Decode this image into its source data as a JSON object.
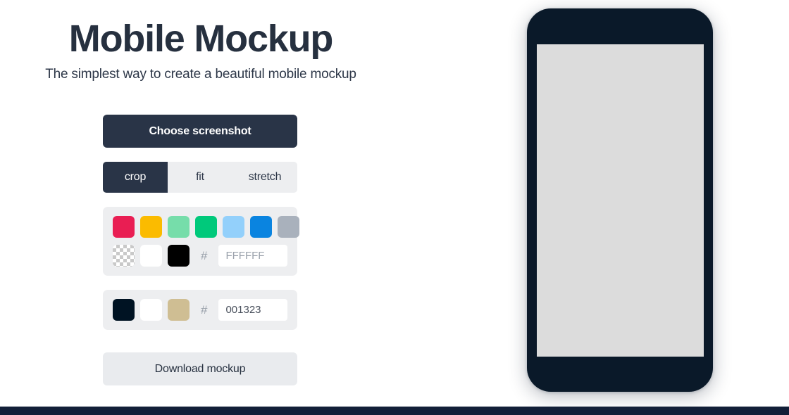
{
  "header": {
    "title": "Mobile Mockup",
    "subtitle": "The simplest way to create a beautiful mobile mockup"
  },
  "controls": {
    "choose_label": "Choose screenshot",
    "download_label": "Download mockup",
    "fit_modes": [
      {
        "label": "crop",
        "active": true
      },
      {
        "label": "fit",
        "active": false
      },
      {
        "label": "stretch",
        "active": false
      }
    ],
    "background_panel": {
      "palette_row": [
        {
          "name": "crimson",
          "hex": "#E91E53"
        },
        {
          "name": "amber",
          "hex": "#FBBB00"
        },
        {
          "name": "mint",
          "hex": "#76DDAA"
        },
        {
          "name": "emerald",
          "hex": "#00C97B"
        },
        {
          "name": "sky",
          "hex": "#93D0FB"
        },
        {
          "name": "blue",
          "hex": "#0A84E0"
        },
        {
          "name": "slate-gray",
          "hex": "#A9B1BC"
        }
      ],
      "neutral_row": [
        {
          "name": "transparent",
          "hex": "transparent"
        },
        {
          "name": "white",
          "hex": "#FFFFFF"
        },
        {
          "name": "black",
          "hex": "#000000"
        }
      ],
      "hash_symbol": "#",
      "hex_value": "",
      "hex_placeholder": "FFFFFF"
    },
    "device_panel": {
      "palette_row": [
        {
          "name": "navy",
          "hex": "#001323"
        },
        {
          "name": "white",
          "hex": "#FFFFFF"
        },
        {
          "name": "tan",
          "hex": "#CFBE93"
        }
      ],
      "hash_symbol": "#",
      "hex_value": "001323",
      "hex_placeholder": "001323"
    }
  },
  "preview": {
    "device_body_color": "#0A1929",
    "device_screen_color": "#DCDCDC"
  },
  "footer": {
    "bar_color": "#121F38"
  }
}
